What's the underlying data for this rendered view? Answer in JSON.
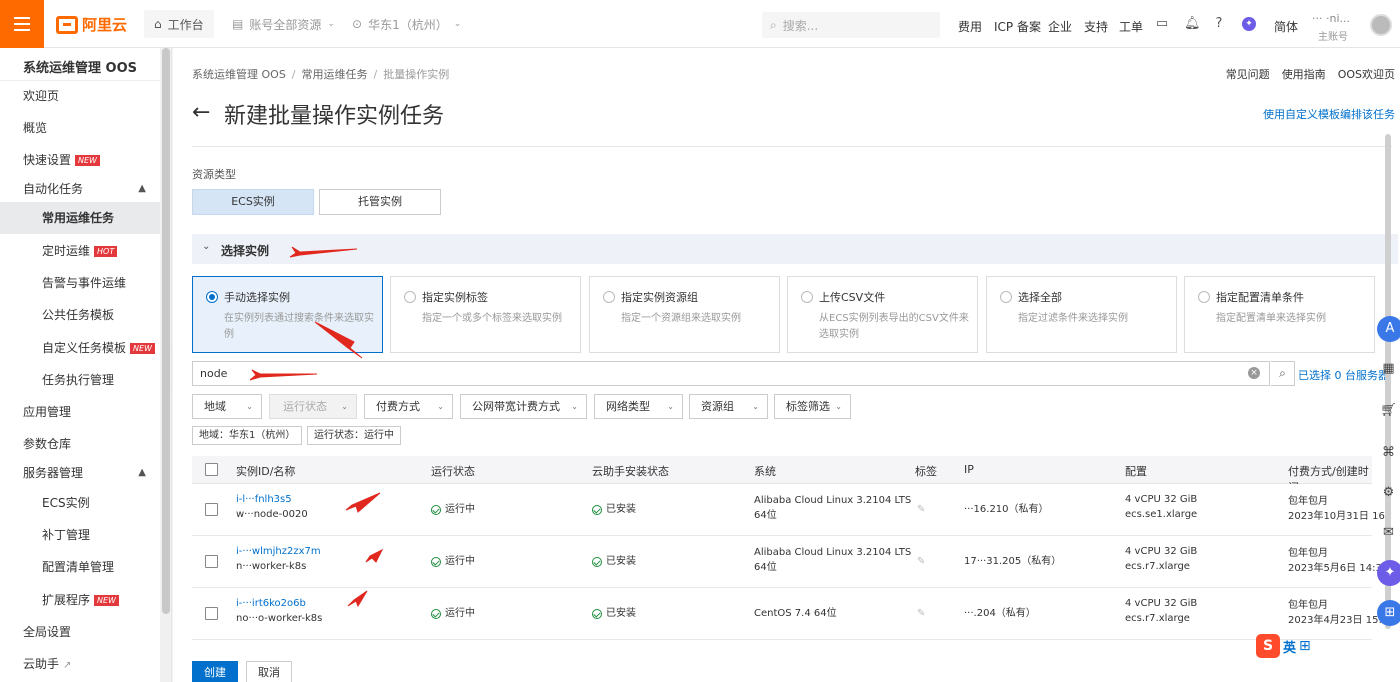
{
  "topbar": {
    "brand": "阿里云",
    "workbench": "工作台",
    "account_scope": "账号全部资源",
    "region": "华东1（杭州）",
    "search_placeholder": "搜索...",
    "links": [
      "费用",
      "ICP 备案",
      "企业",
      "支持",
      "工单"
    ],
    "lang": "简体",
    "user_name": "··· ·ni...",
    "user_role": "主账号"
  },
  "sidebar": {
    "title": "系统运维管理 OOS",
    "items": [
      {
        "label": "欢迎页"
      },
      {
        "label": "概览"
      },
      {
        "label": "快速设置",
        "tag": "NEW"
      },
      {
        "label": "自动化任务"
      },
      {
        "label": "常用运维任务"
      },
      {
        "label": "定时运维",
        "tag": "HOT"
      },
      {
        "label": "告警与事件运维"
      },
      {
        "label": "公共任务模板"
      },
      {
        "label": "自定义任务模板",
        "tag": "NEW"
      },
      {
        "label": "任务执行管理"
      },
      {
        "label": "应用管理"
      },
      {
        "label": "参数仓库"
      },
      {
        "label": "服务器管理"
      },
      {
        "label": "ECS实例"
      },
      {
        "label": "补丁管理"
      },
      {
        "label": "配置清单管理"
      },
      {
        "label": "扩展程序",
        "tag": "NEW"
      },
      {
        "label": "全局设置"
      },
      {
        "label": "云助手"
      }
    ]
  },
  "breadcrumb": [
    "系统运维管理 OOS",
    "常用运维任务",
    "批量操作实例"
  ],
  "top_links": [
    "常见问题",
    "使用指南",
    "OOS欢迎页"
  ],
  "page_title": "新建批量操作实例任务",
  "custom_template_link": "使用自定义模板编排该任务",
  "resource_type": {
    "label": "资源类型",
    "options": [
      "ECS实例",
      "托管实例"
    ]
  },
  "select_section": "选择实例",
  "modes": [
    {
      "title": "手动选择实例",
      "desc": "在实例列表通过搜索条件来选取实例"
    },
    {
      "title": "指定实例标签",
      "desc": "指定一个或多个标签来选取实例"
    },
    {
      "title": "指定实例资源组",
      "desc": "指定一个资源组来选取实例"
    },
    {
      "title": "上传CSV文件",
      "desc": "从ECS实例列表导出的CSV文件来选取实例"
    },
    {
      "title": "选择全部",
      "desc": "指定过滤条件来选择实例"
    },
    {
      "title": "指定配置清单条件",
      "desc": "指定配置清单来选择实例"
    }
  ],
  "filter": {
    "value": "node",
    "selected_count": "已选择 0 台服务器"
  },
  "dropdowns": [
    "地域",
    "运行状态",
    "付费方式",
    "公网带宽计费方式",
    "网络类型",
    "资源组",
    "标签筛选"
  ],
  "chips": [
    "地域：华东1（杭州）",
    "运行状态：运行中"
  ],
  "table": {
    "headers": [
      "实例ID/名称",
      "运行状态",
      "云助手安装状态",
      "系统",
      "标签",
      "IP",
      "配置",
      "付费方式/创建时间"
    ],
    "rows": [
      {
        "id_suffix": "i-l···fnlh3s5",
        "name": "w···node-0020",
        "status": "运行中",
        "agent": "已安装",
        "os": "Alibaba Cloud Linux 3.2104 LTS 64位",
        "ip": "···16.210（私有）",
        "cpu": "4 vCPU 32 GiB",
        "spec": "ecs.se1.xlarge",
        "pay": "包年包月",
        "created": "2023年10月31日 16"
      },
      {
        "id_suffix": "i-···wlmjhz2zx7m",
        "name": "n···worker-k8s",
        "status": "运行中",
        "agent": "已安装",
        "os": "Alibaba Cloud Linux 3.2104 LTS 64位",
        "ip": "17···31.205（私有）",
        "cpu": "4 vCPU 32 GiB",
        "spec": "ecs.r7.xlarge",
        "pay": "包年包月",
        "created": "2023年5月6日 14:3"
      },
      {
        "id_suffix": "i-···irt6ko2o6b",
        "name": "no···o-worker-k8s",
        "status": "运行中",
        "agent": "已安装",
        "os": "CentOS 7.4 64位",
        "ip": "···.204（私有）",
        "cpu": "4 vCPU 32 GiB",
        "spec": "ecs.r7.xlarge",
        "pay": "包年包月",
        "created": "2023年4月23日 15:"
      }
    ]
  },
  "buttons": {
    "create": "创建",
    "cancel": "取消"
  },
  "ime": {
    "mark": "S",
    "lang": "英"
  },
  "colors": {
    "brand": "#ff6a00",
    "primary": "#0070cc",
    "annotation": "#e0281e",
    "success": "#1e8e3e"
  }
}
